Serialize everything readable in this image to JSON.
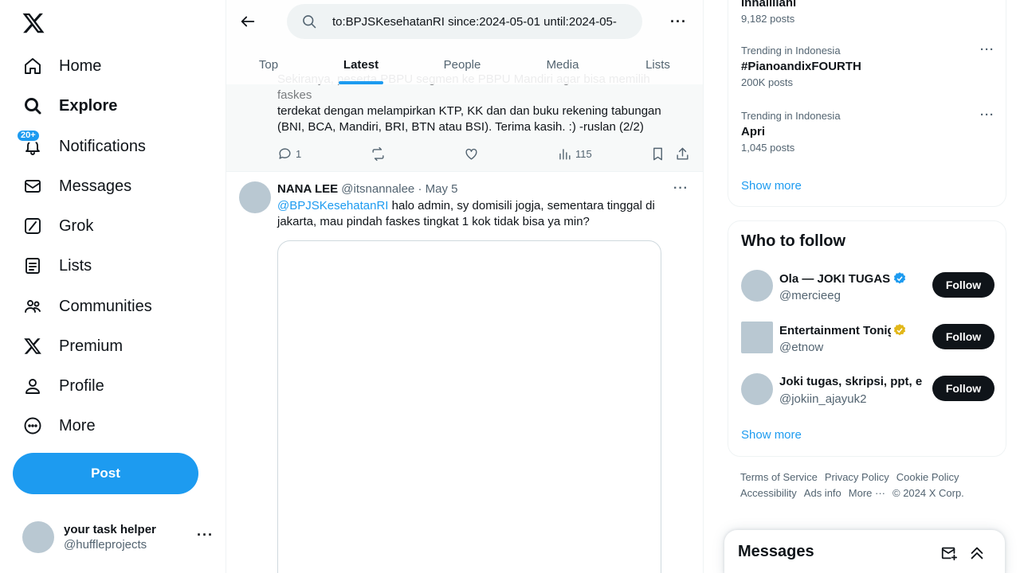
{
  "nav": {
    "items": [
      {
        "label": "Home",
        "icon": "home-icon"
      },
      {
        "label": "Explore",
        "icon": "search-icon"
      },
      {
        "label": "Notifications",
        "icon": "bell-icon",
        "badge": "20+"
      },
      {
        "label": "Messages",
        "icon": "envelope-icon"
      },
      {
        "label": "Grok",
        "icon": "grok-icon"
      },
      {
        "label": "Lists",
        "icon": "lists-icon"
      },
      {
        "label": "Communities",
        "icon": "communities-icon"
      },
      {
        "label": "Premium",
        "icon": "x-logo-icon"
      },
      {
        "label": "Profile",
        "icon": "person-icon"
      },
      {
        "label": "More",
        "icon": "more-circle-icon"
      }
    ],
    "post_label": "Post"
  },
  "account": {
    "display_name": "your task helper",
    "handle": "@huffleprojects"
  },
  "search": {
    "query": "to:BPJSKesehatanRI since:2024-05-01 until:2024-05-",
    "tabs": [
      "Top",
      "Latest",
      "People",
      "Media",
      "Lists"
    ],
    "active_tab": "Latest"
  },
  "prev_tweet": {
    "line_hidden": "Sekiranya, peserta PBPU segmen ke PBPU Mandiri agar bisa memilih faskes",
    "text": "terdekat dengan melampirkan KTP, KK dan dan buku rekening tabungan (BNI, BCA, Mandiri, BRI, BTN atau BSI). Terima kasih. :) -ruslan (2/2)",
    "replies": "1",
    "views": "115"
  },
  "tweet": {
    "author": "NANA LEE",
    "handle": "@itsnannalee",
    "sep": "·",
    "date": "May 5",
    "mention": "@BPJSKesehatanRI",
    "text": " halo admin, sy domisili jogja, sementara tinggal di jakarta, mau pindah faskes tingkat 1 kok tidak bisa ya min?"
  },
  "trends": [
    {
      "context": "",
      "name": "Innalillahi",
      "count": "9,182 posts"
    },
    {
      "context": "Trending in Indonesia",
      "name": "#PianoandixFOURTH",
      "count": "200K posts"
    },
    {
      "context": "Trending in Indonesia",
      "name": "Apri",
      "count": "1,045 posts"
    }
  ],
  "trends_show_more": "Show more",
  "who_to_follow": {
    "title": "Who to follow",
    "users": [
      {
        "name": "Ola — JOKI TUGAS & S",
        "handle": "@mercieeg",
        "verified": "blue",
        "follow": "Follow"
      },
      {
        "name": "Entertainment Tonigh",
        "handle": "@etnow",
        "verified": "gold",
        "follow": "Follow"
      },
      {
        "name": "Joki tugas, skripsi, ppt, e",
        "handle": "@jokiin_ajayuk2",
        "verified": "",
        "follow": "Follow"
      }
    ],
    "show_more": "Show more"
  },
  "footer": [
    "Terms of Service",
    "Privacy Policy",
    "Cookie Policy",
    "Accessibility",
    "Ads info",
    "More ···",
    "© 2024 X Corp."
  ],
  "messages_drawer": {
    "title": "Messages"
  },
  "colors": {
    "accent": "#1d9bf0",
    "text": "#0f1419",
    "muted": "#536471"
  }
}
